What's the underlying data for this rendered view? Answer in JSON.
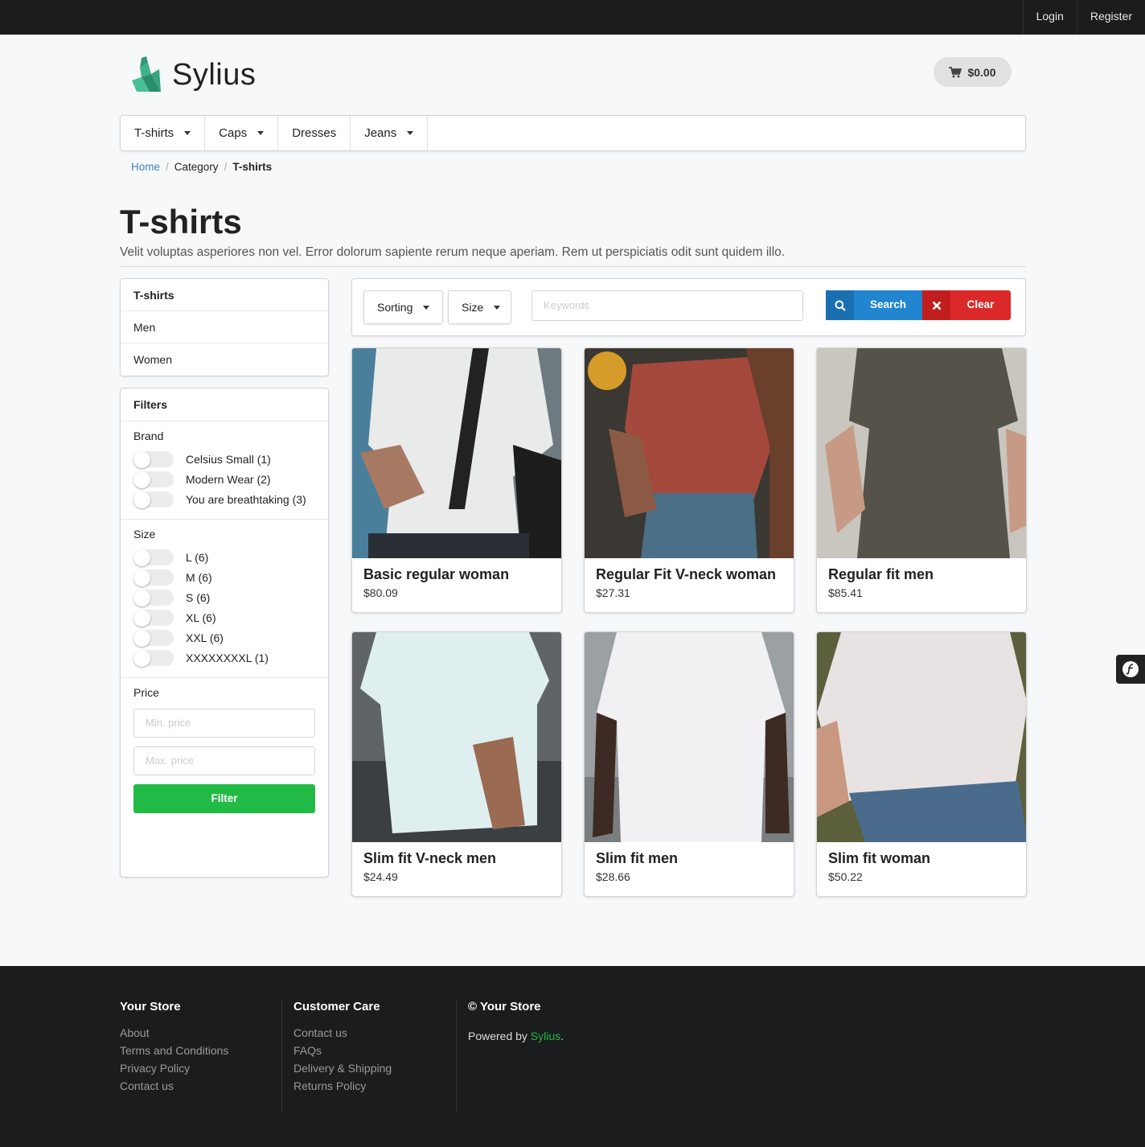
{
  "topbar": {
    "login": "Login",
    "register": "Register"
  },
  "brand": {
    "name": "Sylius",
    "accent": "#3aa882"
  },
  "cart": {
    "total": "$0.00",
    "icon": "cart-icon"
  },
  "nav": [
    {
      "label": "T-shirts",
      "dropdown": true
    },
    {
      "label": "Caps",
      "dropdown": true
    },
    {
      "label": "Dresses",
      "dropdown": false
    },
    {
      "label": "Jeans",
      "dropdown": true
    }
  ],
  "breadcrumb": {
    "home": "Home",
    "category": "Category",
    "current": "T-shirts",
    "sep": "/"
  },
  "page": {
    "title": "T-shirts",
    "description": "Velit voluptas asperiores non vel. Error dolorum sapiente rerum neque aperiam. Rem ut perspiciatis odit sunt quidem illo."
  },
  "categories": {
    "head": "T-shirts",
    "items": [
      "Men",
      "Women"
    ]
  },
  "filters": {
    "head": "Filters",
    "brand": {
      "title": "Brand",
      "options": [
        "Celsius Small (1)",
        "Modern Wear (2)",
        "You are breathtaking (3)"
      ]
    },
    "size": {
      "title": "Size",
      "options": [
        "L (6)",
        "M (6)",
        "S (6)",
        "XL (6)",
        "XXL (6)",
        "XXXXXXXXL (1)"
      ]
    },
    "price": {
      "title": "Price",
      "min_placeholder": "Min. price",
      "max_placeholder": "Max. price",
      "button": "Filter"
    }
  },
  "toolbar": {
    "sorting": "Sorting",
    "size": "Size",
    "keywords_placeholder": "Keywords",
    "search": "Search",
    "clear": "Clear"
  },
  "products": [
    {
      "name": "Basic regular woman",
      "price": "$80.09"
    },
    {
      "name": "Regular Fit V-neck woman",
      "price": "$27.31"
    },
    {
      "name": "Regular fit men",
      "price": "$85.41"
    },
    {
      "name": "Slim fit V-neck men",
      "price": "$24.49"
    },
    {
      "name": "Slim fit men",
      "price": "$28.66"
    },
    {
      "name": "Slim fit woman",
      "price": "$50.22"
    }
  ],
  "footer": {
    "col1": {
      "title": "Your Store",
      "links": [
        "About",
        "Terms and Conditions",
        "Privacy Policy",
        "Contact us"
      ]
    },
    "col2": {
      "title": "Customer Care",
      "links": [
        "Contact us",
        "FAQs",
        "Delivery & Shipping",
        "Returns Policy"
      ]
    },
    "col3": {
      "title": "© Your Store",
      "powered_prefix": "Powered by",
      "powered_link": "Sylius",
      "powered_suffix": "."
    }
  }
}
